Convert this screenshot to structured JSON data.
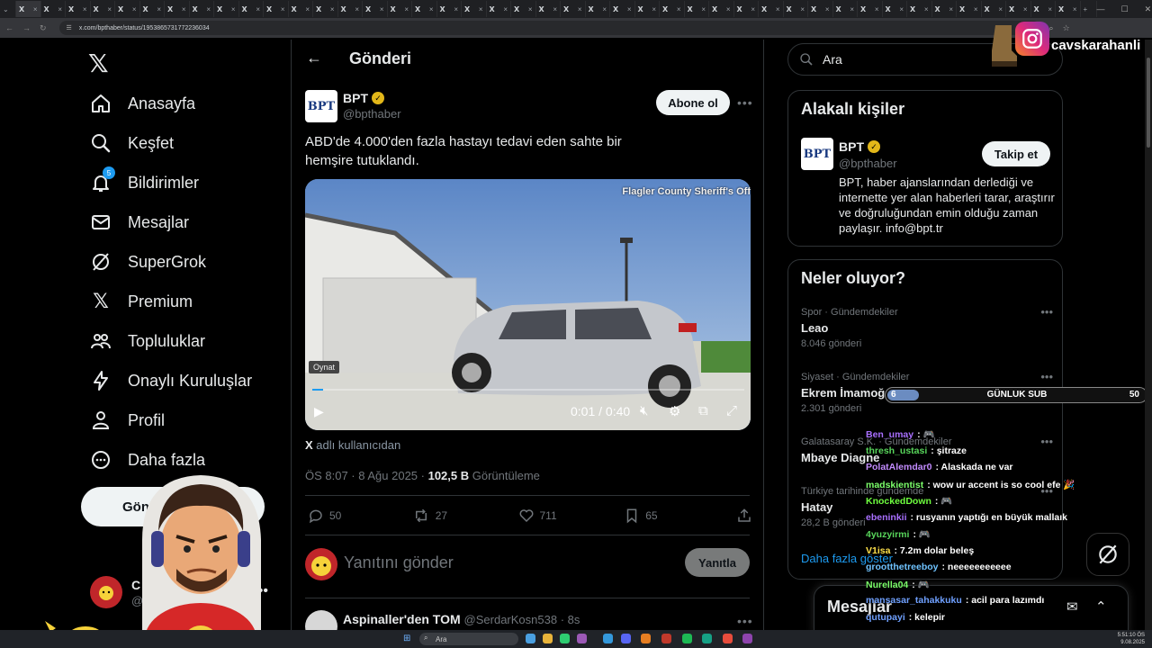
{
  "browser": {
    "url": "x.com/bpthaber/status/1953865731772236034",
    "tab_icon": "X",
    "tab_close": "×",
    "tab_count": 43
  },
  "nav": {
    "items": [
      {
        "label": "Anasayfa",
        "icon": "home-icon"
      },
      {
        "label": "Keşfet",
        "icon": "search-icon"
      },
      {
        "label": "Bildirimler",
        "icon": "bell-icon",
        "badge": "5"
      },
      {
        "label": "Mesajlar",
        "icon": "mail-icon"
      },
      {
        "label": "SuperGrok",
        "icon": "grok-icon"
      },
      {
        "label": "Premium",
        "icon": "x-icon"
      },
      {
        "label": "Topluluklar",
        "icon": "people-icon"
      },
      {
        "label": "Onaylı Kuruluşlar",
        "icon": "bolt-icon"
      },
      {
        "label": "Profil",
        "icon": "person-icon"
      },
      {
        "label": "Daha fazla",
        "icon": "more-circle-icon"
      }
    ],
    "post_button": "Gönder",
    "account_name": "C",
    "account_handle": "@c"
  },
  "post": {
    "header_title": "Gönderi",
    "author_name": "BPT",
    "author_handle": "@bpthaber",
    "subscribe_label": "Abone ol",
    "text": "ABD'de 4.000'den fazla hastayı tedavi eden sahte bir hemşire tutuklandı.",
    "video": {
      "watermark": "Flagler County Sheriff's Off",
      "tooltip": "Oynat",
      "time": "0:01 / 0:40",
      "progress": 0.025
    },
    "from_x": "X",
    "from_text": "adlı kullanıcıdan",
    "time": "ÖS 8:07 · 8 Ağu 2025 · ",
    "views": "102,5 B",
    "views_label": "Görüntüleme",
    "replies": "50",
    "reposts": "27",
    "likes": "711",
    "bookmarks": "65",
    "reply_placeholder": "Yanıtını gönder",
    "reply_button": "Yanıtla",
    "next_author": "Aspinaller'den TOM",
    "next_handle": "@SerdarKosn538 · 8s"
  },
  "right": {
    "search_placeholder": "Ara",
    "related_title": "Alakalı kişiler",
    "related_name": "BPT",
    "related_handle": "@bpthaber",
    "follow_label": "Takip et",
    "related_bio": "BPT, haber ajanslarından derlediği ve internette yer alan haberleri tarar, araştırır ve doğruluğundan emin olduğu zaman paylaşır. info@bpt.tr",
    "trending_title": "Neler oluyor?",
    "trends": [
      {
        "category": "Spor · Gündemdekiler",
        "name": "Leao",
        "count": "8.046 gönderi"
      },
      {
        "category": "Siyaset · Gündemdekiler",
        "name": "Ekrem İmamoğ",
        "count": "2.301 gönderi"
      },
      {
        "category": "Galatasaray S.K. · Gündemdekiler",
        "name": "Mbaye Diagne",
        "count": ""
      },
      {
        "category": "Türkiye tarihinde gündemde",
        "name": "Hatay",
        "count": "28,2 B gönderi"
      }
    ],
    "show_more": "Daha fazla göster",
    "messages_title": "Mesajlar"
  },
  "overlay": {
    "instagram": "cavskarahanli",
    "sub_level": "6",
    "sub_label": "GÜNLUK SUB",
    "sub_goal": "50",
    "sub_progress": 0.12,
    "chat": [
      {
        "user": "Ben_umay",
        "color": "#a970ff",
        "msg": ": 🎮"
      },
      {
        "user": "thresh_ustasi",
        "color": "#58d65b",
        "msg": ": şitraze"
      },
      {
        "user": "PolatAlemdar0",
        "color": "#c38cff",
        "msg": ": Alaskada ne var"
      },
      {
        "user": "madskientist",
        "color": "#7cff6b",
        "msg": ": wow ur accent is so cool efe 🎉"
      },
      {
        "user": "KnockedDown",
        "color": "#6fff3f",
        "msg": ": 🎮"
      },
      {
        "user": "ebeninkii",
        "color": "#a970ff",
        "msg": ": rusyanın yaptığı en büyük mallaık"
      },
      {
        "user": "4yuzyirmi",
        "color": "#58d65b",
        "msg": ": 🎮"
      },
      {
        "user": "V1isa",
        "color": "#ffe14a",
        "msg": ": 7.2m dolar beleş"
      },
      {
        "user": "grootthetreeboy",
        "color": "#6fc3ff",
        "msg": ": neeeeeeeeeee"
      },
      {
        "user": "Nurella04",
        "color": "#7cff6b",
        "msg": ": 🎮"
      },
      {
        "user": "mansasar_tahakkuku",
        "color": "#6fa0ff",
        "msg": ": acil para lazımdı"
      },
      {
        "user": "qutupayi",
        "color": "#6fa0ff",
        "msg": ": kelepir"
      }
    ]
  },
  "taskbar": {
    "search": "Ara",
    "time": "5:51:10 ÖS",
    "date": "9.08.2025"
  }
}
